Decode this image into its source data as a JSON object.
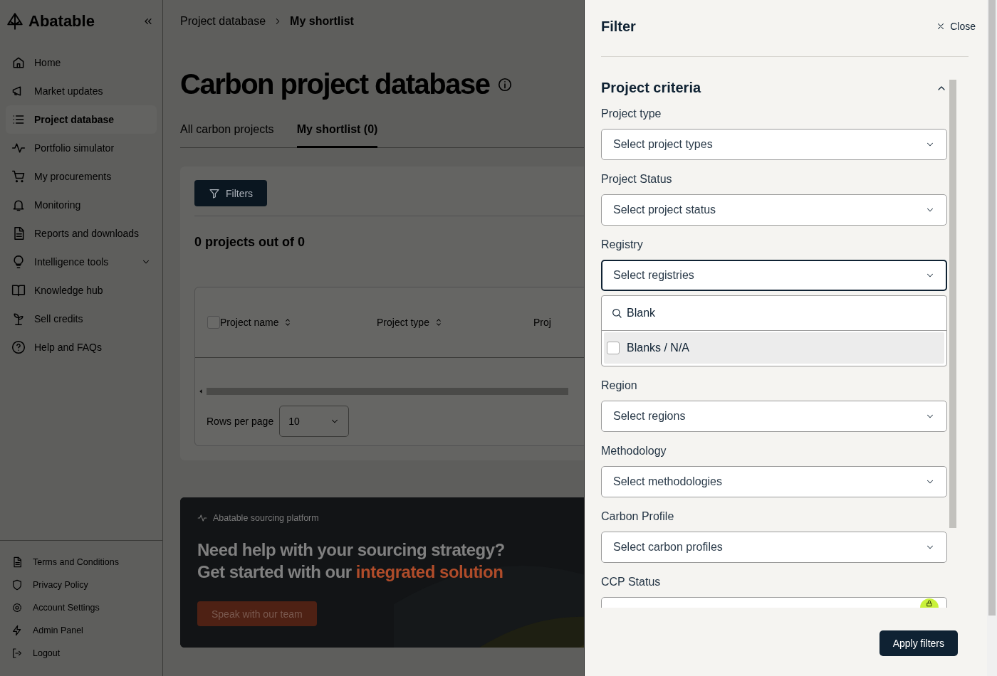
{
  "sidebar": {
    "logo": "Abatable",
    "nav": [
      {
        "label": "Home",
        "selected": false
      },
      {
        "label": "Market updates",
        "selected": false
      },
      {
        "label": "Project database",
        "selected": true
      },
      {
        "label": "Portfolio simulator",
        "selected": false
      },
      {
        "label": "My procurements",
        "selected": false
      },
      {
        "label": "Monitoring",
        "selected": false
      },
      {
        "label": "Reports and downloads",
        "selected": false
      },
      {
        "label": "Intelligence tools",
        "selected": false,
        "expandable": true
      },
      {
        "label": "Knowledge hub",
        "selected": false
      },
      {
        "label": "Sell credits",
        "selected": false
      },
      {
        "label": "Help and FAQs",
        "selected": false
      }
    ],
    "footer": [
      "Terms and Conditions",
      "Privacy Policy",
      "Account Settings",
      "Admin Panel",
      "Logout"
    ]
  },
  "breadcrumb": [
    "Project database",
    "My shortlist"
  ],
  "page_title": "Carbon project database",
  "tabs": [
    {
      "label": "All carbon projects",
      "selected": false
    },
    {
      "label": "My shortlist (0)",
      "selected": true
    }
  ],
  "filters_button": "Filters",
  "result_count": "0 projects out of 0",
  "table": {
    "select_all_checked": false,
    "columns": [
      {
        "label": "Project name",
        "sortable": true
      },
      {
        "label": "Project type",
        "sortable": true
      },
      {
        "label": "Proj",
        "sortable": false
      }
    ]
  },
  "pagination": {
    "label": "Rows per page",
    "value": "10"
  },
  "promo": {
    "eyebrow": "Abatable sourcing platform",
    "headline": "Need help with your sourcing strategy?",
    "subline": "Get started with our",
    "highlight": "integrated solution",
    "button": "Speak with our team"
  },
  "drawer": {
    "title": "Filter",
    "close": "Close",
    "section": {
      "title": "Project criteria",
      "expanded": true,
      "fields": [
        {
          "label": "Project type",
          "placeholder": "Select project types",
          "open": false
        },
        {
          "label": "Project Status",
          "placeholder": "Select project status",
          "open": false
        },
        {
          "label": "Registry",
          "placeholder": "Select registries",
          "open": true,
          "search": "Blank",
          "options": [
            {
              "label": "Blanks / N/A",
              "checked": false
            }
          ]
        },
        {
          "label": "Region",
          "placeholder": "Select regions",
          "open": false
        },
        {
          "label": "Methodology",
          "placeholder": "Select methodologies",
          "open": false
        },
        {
          "label": "Carbon Profile",
          "placeholder": "Select carbon profiles",
          "open": false
        },
        {
          "label": "CCP Status",
          "open": false
        }
      ]
    },
    "apply": "Apply filters"
  }
}
